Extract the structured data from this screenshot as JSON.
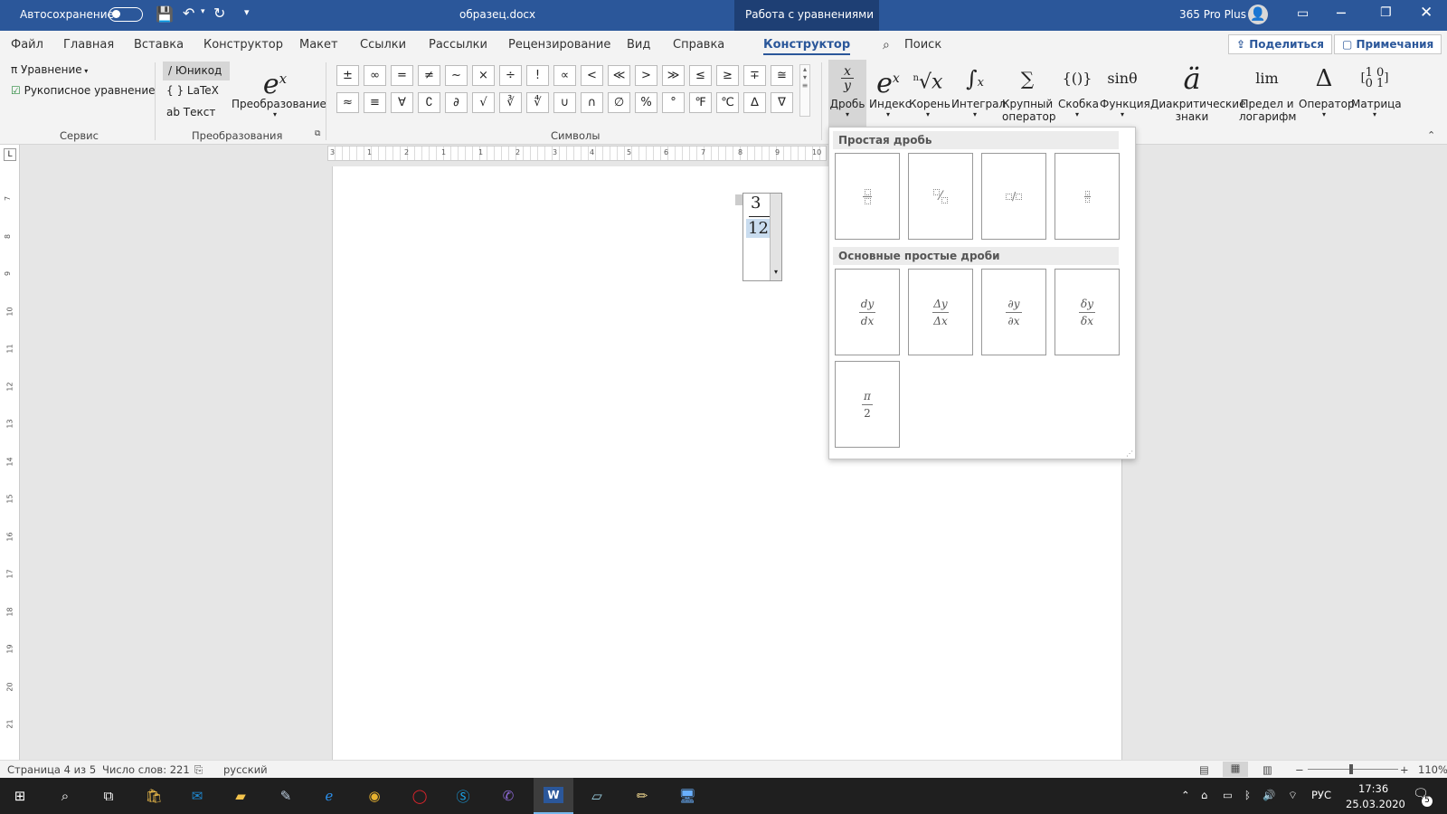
{
  "titlebar": {
    "autosave": "Автосохранение",
    "filename": "образец.docx",
    "context_tab": "Работа с уравнениями",
    "license": "365 Pro Plus"
  },
  "menu": {
    "items": [
      "Файл",
      "Главная",
      "Вставка",
      "Конструктор",
      "Макет",
      "Ссылки",
      "Рассылки",
      "Рецензирование",
      "Вид",
      "Справка",
      "Конструктор"
    ],
    "search": "Поиск",
    "share": "Поделиться",
    "comments": "Примечания"
  },
  "ribbon": {
    "service": {
      "equation": "Уравнение",
      "handwritten": "Рукописное уравнение",
      "label": "Сервис"
    },
    "conversion": {
      "unicode": "Юникод",
      "latex": "LaTeX",
      "text": "Текст",
      "convert": "Преобразование",
      "label": "Преобразования"
    },
    "symbols": {
      "label": "Символы",
      "row1": [
        "±",
        "∞",
        "=",
        "≠",
        "~",
        "×",
        "÷",
        "!",
        "∝",
        "<",
        "≪",
        ">",
        "≫",
        "≤",
        "≥",
        "∓",
        "≅"
      ],
      "row2": [
        "≈",
        "≡",
        "∀",
        "∁",
        "∂",
        "√",
        "∛",
        "∜",
        "∪",
        "∩",
        "∅",
        "%",
        "°",
        "℉",
        "℃",
        "∆",
        "∇"
      ]
    },
    "structures": [
      {
        "icon": "x/y",
        "label": "Дробь"
      },
      {
        "icon": "eˣ",
        "label": "Индекс"
      },
      {
        "icon": "ⁿ√x",
        "label": "Корень"
      },
      {
        "icon": "∫",
        "label": "Интеграл"
      },
      {
        "icon": "∑",
        "label": "Крупный оператор"
      },
      {
        "icon": "{()}",
        "label": "Скобка"
      },
      {
        "icon": "sinθ",
        "label": "Функция"
      },
      {
        "icon": "ä",
        "label": "Диакритические знаки"
      },
      {
        "icon": "lim",
        "label": "Предел и логарифм"
      },
      {
        "icon": "Δ",
        "label": "Оператор"
      },
      {
        "icon": "[10/01]",
        "label": "Матрица"
      }
    ]
  },
  "equation": {
    "numerator": "3",
    "denominator": "12"
  },
  "gallery": {
    "section1": "Простая дробь",
    "section2": "Основные простые дроби",
    "common": [
      {
        "num": "dy",
        "den": "dx"
      },
      {
        "num": "Δy",
        "den": "Δx"
      },
      {
        "num": "∂y",
        "den": "∂x"
      },
      {
        "num": "δy",
        "den": "δx"
      },
      {
        "num": "π",
        "den": "2"
      }
    ],
    "skewed": "⁄",
    "linear": "/"
  },
  "status": {
    "page": "Страница 4 из 5",
    "words": "Число слов: 221",
    "language": "русский",
    "zoom": "110%"
  },
  "taskbar": {
    "lang": "РУС",
    "time": "17:36",
    "date": "25.03.2020",
    "notif": "5"
  },
  "rulers": {
    "h": [
      "3",
      "1",
      "2",
      "1",
      "1",
      "2",
      "3",
      "4",
      "5",
      "6",
      "7",
      "8",
      "9",
      "10"
    ],
    "v": [
      "7",
      "8",
      "9",
      "10",
      "11",
      "12",
      "13",
      "14",
      "15",
      "16",
      "17",
      "18",
      "19",
      "20",
      "21"
    ]
  }
}
